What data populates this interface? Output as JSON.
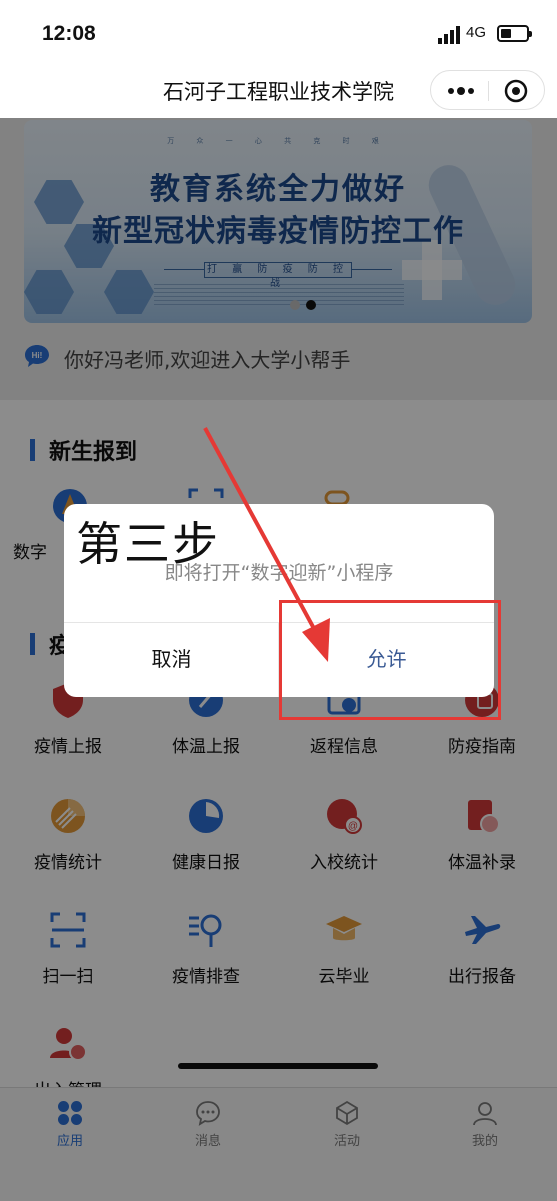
{
  "status_bar": {
    "time": "12:08",
    "network": "4G"
  },
  "header": {
    "title": "石河子工程职业技术学院"
  },
  "banner": {
    "tiny_text": "万 众 一 心    共 克 时 艰",
    "line1": "教育系统全力做好",
    "line2": "新型冠状病毒疫情防控工作",
    "slogan": "打 赢 防 疫 防 控 战",
    "slide_count": 2,
    "active_slide": 2
  },
  "greeting": {
    "text": "你好冯老师,欢迎进入大学小帮手"
  },
  "sections": {
    "freshman": {
      "title": "新生报到",
      "partial_label": "数字"
    },
    "epidemic": {
      "title_partial": "疫"
    }
  },
  "grid": {
    "row1": [
      "疫情上报",
      "体温上报",
      "返程信息",
      "防疫指南"
    ],
    "row2": [
      "疫情统计",
      "健康日报",
      "入校统计",
      "体温补录"
    ],
    "row3": [
      "扫一扫",
      "疫情排查",
      "云毕业",
      "出行报备"
    ],
    "row4": [
      "出入管理"
    ]
  },
  "tabbar": {
    "apps": "应用",
    "messages": "消息",
    "activities": "活动",
    "mine": "我的"
  },
  "dialog": {
    "message": "即将打开“数字迎新”小程序",
    "cancel": "取消",
    "allow": "允许"
  },
  "annotation": {
    "step_label": "第三步",
    "highlight_color": "#e53935"
  },
  "colors": {
    "accent": "#2c6fd6",
    "icon_red": "#d23a3a",
    "icon_orange": "#e39a3a",
    "icon_blue": "#2c6fd6"
  }
}
